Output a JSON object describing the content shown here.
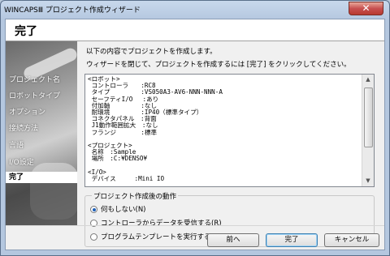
{
  "window": {
    "title": "WINCAPSⅢ プロジェクト作成ウィザード",
    "close_glyph": "✕"
  },
  "header": {
    "title": "完了"
  },
  "sidebar": {
    "items": [
      {
        "label": "プロジェクト名"
      },
      {
        "label": "ロボットタイプ"
      },
      {
        "label": "オプション"
      },
      {
        "label": "接続方法"
      },
      {
        "label": "言語"
      },
      {
        "label": "I/O設定"
      },
      {
        "label": "完了",
        "current": true
      }
    ]
  },
  "content": {
    "intro_line1": "以下の内容でプロジェクトを作成します。",
    "intro_line2": "ウィザードを閉じて、プロジェクトを作成するには [完了] をクリックしてください。",
    "summary_text": "<ロボット>\n コントローラ　　:RC8\n タイプ　　　　　:VS050A3-AV6-NNN-NNN-A\n セーフティI/O　 :あり\n 付加軸　　　　　:なし\n 耐環境　　　　　:IP40（標準タイプ）\n コネクタパネル　:背面\n J1動作範囲拡大　:なし\n フランジ　　　　:標準\n\n<プロジェクト>\n 名称　:Sample\n 場所　:C:¥DENSO¥\n\n<I/O>\n デバイス　　　:Mini IO"
  },
  "post_action": {
    "group_title": "プロジェクト作成後の動作",
    "options": [
      {
        "label": "何もしない(N)",
        "selected": true
      },
      {
        "label": "コントローラからデータを受信する(R)",
        "selected": false
      },
      {
        "label": "プログラムテンプレートを実行する(T)",
        "selected": false
      }
    ]
  },
  "buttons": {
    "back": "前へ",
    "finish": "完了",
    "cancel": "キャンセル"
  }
}
